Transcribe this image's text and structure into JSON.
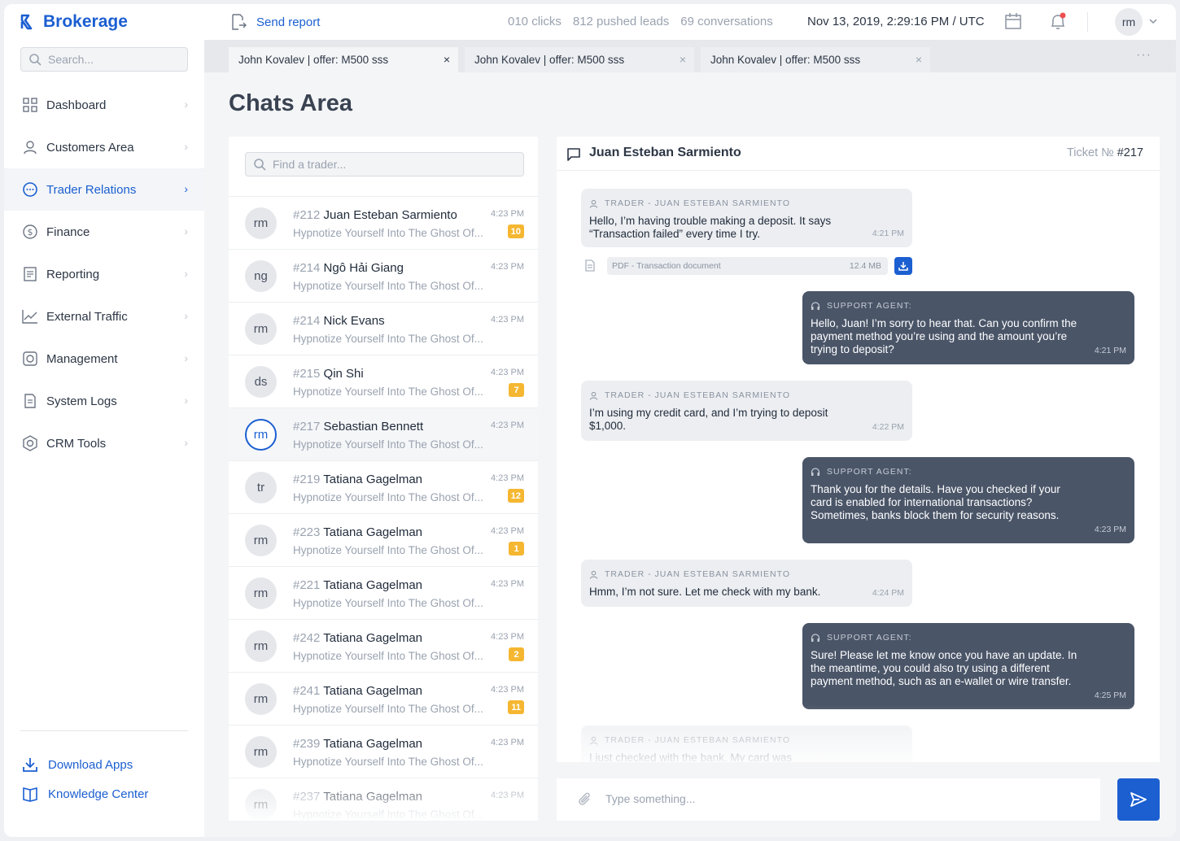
{
  "app": {
    "brand": "Brokerage"
  },
  "sidebar": {
    "search_placeholder": "Search...",
    "items": [
      {
        "label": "Dashboard",
        "icon": "grid-icon"
      },
      {
        "label": "Customers Area",
        "icon": "user-icon"
      },
      {
        "label": "Trader Relations",
        "icon": "chat-icon",
        "active": true
      },
      {
        "label": "Finance",
        "icon": "dollar-icon"
      },
      {
        "label": "Reporting",
        "icon": "report-icon"
      },
      {
        "label": "External Traffic",
        "icon": "chart-line-icon"
      },
      {
        "label": "Management",
        "icon": "gear-icon"
      },
      {
        "label": "System Logs",
        "icon": "document-icon"
      },
      {
        "label": "CRM Tools",
        "icon": "settings-icon"
      }
    ],
    "download_apps": "Download Apps",
    "knowledge_center": "Knowledge Center"
  },
  "topbar": {
    "send_report": "Send report",
    "clicks": "010 clicks",
    "pushed_leads": "812 pushed leads",
    "conversations": "69 conversations",
    "datetime": "Nov 13, 2019, 2:29:16 PM / UTC",
    "avatar": "rm"
  },
  "tabs": [
    {
      "label": "John Kovalev | offer: M500 sss",
      "close": "×"
    },
    {
      "label": "John Kovalev | offer: M500 sss",
      "close": "×"
    },
    {
      "label": "John Kovalev | offer: M500 sss",
      "close": "×"
    }
  ],
  "tabs_more": "···",
  "page": {
    "title": "Chats Area"
  },
  "chat_list": {
    "search_placeholder": "Find a trader...",
    "items": [
      {
        "initials": "rm",
        "num": "#212",
        "name": "Juan Esteban Sarmiento",
        "time": "4:23 PM",
        "preview": "Hypnotize Yourself Into The Ghost Of...",
        "badge": "10"
      },
      {
        "initials": "ng",
        "num": "#214",
        "name": "Ngô Hải Giang",
        "time": "4:23 PM",
        "preview": "Hypnotize Yourself Into The Ghost Of...",
        "badge": ""
      },
      {
        "initials": "rm",
        "num": "#214",
        "name": "Nick Evans",
        "time": "4:23 PM",
        "preview": "Hypnotize Yourself Into The Ghost Of...",
        "badge": ""
      },
      {
        "initials": "ds",
        "num": "#215",
        "name": "Qin Shi",
        "time": "4:23 PM",
        "preview": "Hypnotize Yourself Into The Ghost Of...",
        "badge": "7"
      },
      {
        "initials": "rm",
        "num": "#217",
        "name": "Sebastian Bennett",
        "time": "4:23 PM",
        "preview": "Hypnotize Yourself Into The Ghost Of...",
        "badge": "",
        "selected": true
      },
      {
        "initials": "tr",
        "num": "#219",
        "name": "Tatiana Gagelman",
        "time": "4:23 PM",
        "preview": "Hypnotize Yourself Into The Ghost Of...",
        "badge": "12"
      },
      {
        "initials": "rm",
        "num": "#223",
        "name": "Tatiana Gagelman",
        "time": "4:23 PM",
        "preview": "Hypnotize Yourself Into The Ghost Of...",
        "badge": "1"
      },
      {
        "initials": "rm",
        "num": "#221",
        "name": "Tatiana Gagelman",
        "time": "4:23 PM",
        "preview": "Hypnotize Yourself Into The Ghost Of...",
        "badge": ""
      },
      {
        "initials": "rm",
        "num": "#242",
        "name": "Tatiana Gagelman",
        "time": "4:23 PM",
        "preview": "Hypnotize Yourself Into The Ghost Of...",
        "badge": "2"
      },
      {
        "initials": "rm",
        "num": "#241",
        "name": "Tatiana Gagelman",
        "time": "4:23 PM",
        "preview": "Hypnotize Yourself Into The Ghost Of...",
        "badge": "11"
      },
      {
        "initials": "rm",
        "num": "#239",
        "name": "Tatiana Gagelman",
        "time": "4:23 PM",
        "preview": "Hypnotize Yourself Into The Ghost Of...",
        "badge": ""
      },
      {
        "initials": "rm",
        "num": "#237",
        "name": "Tatiana Gagelman",
        "time": "4:23 PM",
        "preview": "Hypnotize Yourself Into The Ghost Of...",
        "badge": ""
      }
    ]
  },
  "chat": {
    "name": "Juan Esteban Sarmiento",
    "ticket_label": "Ticket №",
    "ticket_num": "#217",
    "messages": [
      {
        "from": "TRADER - JUAN ESTEBAN SARMIENTO",
        "text": "Hello, I’m having trouble making a deposit. It says “Transaction failed” every time I try.",
        "time": "4:21 PM"
      },
      {
        "from": "SUPPORT AGENT:",
        "text": "Hello, Juan! I’m sorry to hear that. Can you confirm the payment method you’re using and the amount you’re trying to deposit?",
        "time": "4:21 PM"
      },
      {
        "from": "TRADER - JUAN ESTEBAN SARMIENTO",
        "text": "I’m using my credit card, and I’m trying to deposit $1,000.",
        "time": "4:22 PM"
      },
      {
        "from": "SUPPORT AGENT:",
        "text": "Thank you for the details. Have you checked if your card is enabled for international transactions? Sometimes, banks block them for security reasons.",
        "time": "4:23 PM"
      },
      {
        "from": "TRADER - JUAN ESTEBAN SARMIENTO",
        "text": "Hmm, I’m not sure. Let me check with my bank.",
        "time": "4:24 PM"
      },
      {
        "from": "SUPPORT AGENT:",
        "text": "Sure! Please let me know once you have an update. In the meantime, you could also try using a different payment method, such as an e-wallet or wire transfer.",
        "time": "4:25 PM"
      },
      {
        "from": "TRADER - JUAN ESTEBAN SARMIENTO",
        "text": "I just checked with the bank. My card was",
        "time": ""
      }
    ],
    "attachment": {
      "name": "PDF - Transaction document",
      "size": "12.4 MB"
    },
    "compose_placeholder": "Type something..."
  },
  "colors": {
    "accent": "#1b5fd1",
    "agent_bubble": "#4a5568",
    "badge": "#f5b731"
  }
}
